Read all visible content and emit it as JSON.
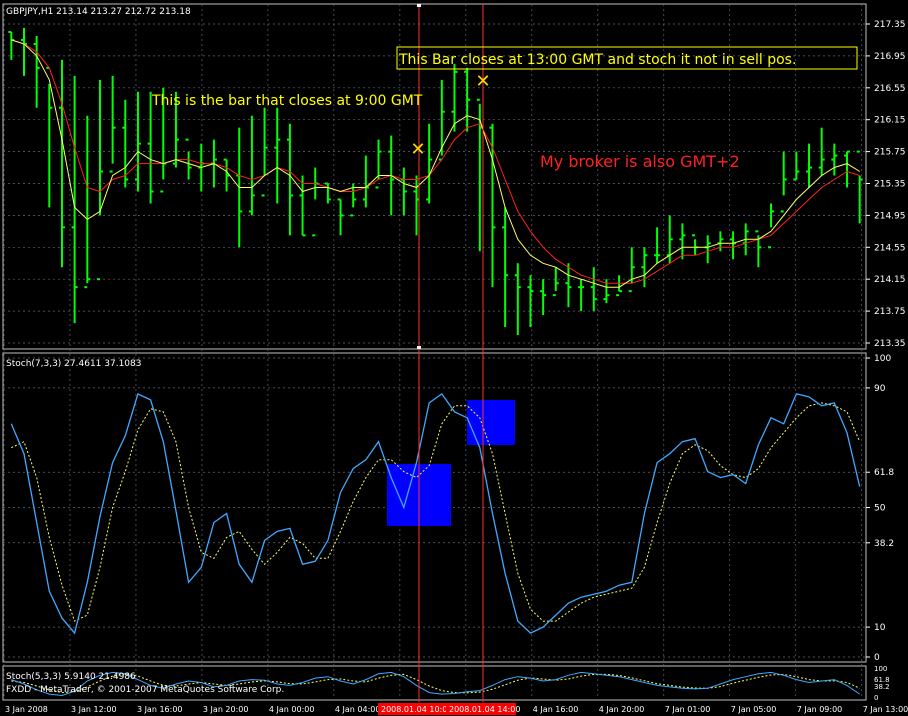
{
  "window": {
    "symbol_header": "GBPJPY,H1  213.14 213.27 212.72 213.18",
    "copyright": "FXDD - MetaTrader, © 2001-2007 MetaQuotes Software Corp."
  },
  "annotations": {
    "bar_9": "This is the bar that closes at 9:00 GMT",
    "bar_13": "This Bar closes at 13:00 GMT and stoch it not in sell pos.",
    "broker": "My broker is also GMT+2"
  },
  "colors": {
    "background": "#000000",
    "grid": "#5a6a78",
    "candle": "#00ff00",
    "ma_fast": "#ffff66",
    "ma_slow": "#ff2020",
    "stoch_main": "#3fa9ff",
    "stoch_signal": "#ffff66",
    "highlight_box": "#0000ff",
    "vline": "#ff3030",
    "axis_text": "#ffffff",
    "note_yellow": "#ffff00",
    "note_red": "#ff2020"
  },
  "chart_data": [
    {
      "type": "candlestick",
      "title": "GBPJPY,H1  213.14 213.27 212.72 213.18",
      "y_ticks": [
        "217.35",
        "216.95",
        "216.55",
        "216.15",
        "215.75",
        "215.35",
        "214.95",
        "214.55",
        "214.15",
        "213.75",
        "213.35"
      ],
      "ylim": [
        213.3,
        217.5
      ],
      "close": [
        217.15,
        217.1,
        216.8,
        216.3,
        214.8,
        214.05,
        214.15,
        215.5,
        216.05,
        215.4,
        215.85,
        215.25,
        215.6,
        215.9,
        215.55,
        215.6,
        215.65,
        215.45,
        215.0,
        215.2,
        215.8,
        215.9,
        215.2,
        214.7,
        215.35,
        215.15,
        214.95,
        215.15,
        215.3,
        215.75,
        215.4,
        215.25,
        215.15,
        215.65,
        216.25,
        216.75,
        216.4,
        216.05,
        214.8,
        214.2,
        214.05,
        214.0,
        213.95,
        214.1,
        214.05,
        214.05,
        213.9,
        213.95,
        214.0,
        214.3,
        214.45,
        214.45,
        214.65,
        214.7,
        214.55,
        214.6,
        214.65,
        214.6,
        214.75,
        214.55,
        215.0,
        215.4,
        215.5,
        215.55,
        215.65,
        215.7,
        215.75,
        215.4
      ],
      "high": [
        217.25,
        217.3,
        217.2,
        216.6,
        216.9,
        216.7,
        216.2,
        216.65,
        216.7,
        216.4,
        216.5,
        216.5,
        216.55,
        216.5,
        215.75,
        215.85,
        215.9,
        215.65,
        216.05,
        216.2,
        216.3,
        216.3,
        216.1,
        215.45,
        215.55,
        215.35,
        215.15,
        215.35,
        215.7,
        215.9,
        215.95,
        215.55,
        215.45,
        216.1,
        216.65,
        216.85,
        216.8,
        216.35,
        216.1,
        215.05,
        214.35,
        214.2,
        214.15,
        214.3,
        214.35,
        214.15,
        214.3,
        214.15,
        214.2,
        214.55,
        214.55,
        214.8,
        214.95,
        214.85,
        214.65,
        214.7,
        214.75,
        214.75,
        214.85,
        214.7,
        215.1,
        215.75,
        215.75,
        215.85,
        216.05,
        215.85,
        215.75,
        215.45
      ],
      "low": [
        216.9,
        216.7,
        216.3,
        215.05,
        214.3,
        213.6,
        214.1,
        214.95,
        215.6,
        215.3,
        215.25,
        215.1,
        215.4,
        215.55,
        215.4,
        215.25,
        215.3,
        215.25,
        214.55,
        214.95,
        215.45,
        215.1,
        214.7,
        214.7,
        215.15,
        215.1,
        214.7,
        215.05,
        215.05,
        215.4,
        214.95,
        214.95,
        214.7,
        215.1,
        215.7,
        216.0,
        216.0,
        214.5,
        214.05,
        213.55,
        213.45,
        213.55,
        213.7,
        214.0,
        213.8,
        213.75,
        213.75,
        213.85,
        214.0,
        214.1,
        214.05,
        214.35,
        214.35,
        214.4,
        214.45,
        214.35,
        214.5,
        214.4,
        214.45,
        214.3,
        214.8,
        215.2,
        215.4,
        215.3,
        215.45,
        215.45,
        215.3,
        214.85
      ],
      "ma_fast": [
        217.15,
        217.1,
        216.95,
        216.65,
        215.9,
        215.05,
        214.9,
        215.0,
        215.45,
        215.55,
        215.75,
        215.65,
        215.6,
        215.65,
        215.6,
        215.55,
        215.6,
        215.5,
        215.3,
        215.3,
        215.45,
        215.55,
        215.45,
        215.25,
        215.3,
        215.3,
        215.25,
        215.3,
        215.3,
        215.45,
        215.45,
        215.35,
        215.3,
        215.45,
        215.8,
        216.1,
        216.2,
        216.15,
        215.65,
        215.05,
        214.65,
        214.45,
        214.35,
        214.3,
        214.2,
        214.15,
        214.1,
        214.05,
        214.05,
        214.15,
        214.2,
        214.35,
        214.45,
        214.55,
        214.55,
        214.55,
        214.6,
        214.6,
        214.65,
        214.65,
        214.75,
        214.95,
        215.15,
        215.3,
        215.45,
        215.55,
        215.6,
        215.5
      ],
      "ma_slow": [
        217.15,
        217.1,
        217.0,
        216.8,
        216.35,
        215.8,
        215.3,
        215.25,
        215.4,
        215.45,
        215.6,
        215.6,
        215.6,
        215.65,
        215.65,
        215.6,
        215.6,
        215.55,
        215.45,
        215.4,
        215.45,
        215.55,
        215.5,
        215.35,
        215.35,
        215.3,
        215.25,
        215.25,
        215.3,
        215.4,
        215.45,
        215.4,
        215.4,
        215.45,
        215.65,
        215.9,
        216.05,
        216.1,
        215.8,
        215.4,
        215.0,
        214.75,
        214.55,
        214.4,
        214.3,
        214.2,
        214.15,
        214.1,
        214.1,
        214.1,
        214.15,
        214.25,
        214.35,
        214.45,
        214.45,
        214.5,
        214.55,
        214.55,
        214.6,
        214.65,
        214.7,
        214.85,
        215.0,
        215.15,
        215.3,
        215.4,
        215.5,
        215.45
      ]
    },
    {
      "type": "line",
      "title": "Stoch(7,3,3) 27.4611 37.1083",
      "y_ticks": [
        "100",
        "90",
        "61.8",
        "50",
        "38.2",
        "10",
        "0"
      ],
      "ylim": [
        0,
        100
      ],
      "series": [
        {
          "values": [
            78,
            68,
            45,
            22,
            13,
            8,
            25,
            47,
            65,
            74,
            88,
            86,
            72,
            49,
            25,
            30,
            45,
            48,
            31,
            25,
            39,
            42,
            43,
            31,
            32,
            39,
            55,
            63,
            66,
            72,
            60,
            50,
            65,
            85,
            88,
            82,
            80,
            70,
            48,
            28,
            12,
            8,
            10,
            14,
            18,
            20,
            21,
            22,
            24,
            25,
            48,
            65,
            68,
            72,
            73,
            62,
            60,
            61,
            58,
            71,
            80,
            78,
            88,
            87,
            84,
            85,
            75,
            57
          ]
        },
        {
          "values": [
            70,
            72,
            60,
            40,
            24,
            12,
            14,
            30,
            50,
            62,
            76,
            83,
            82,
            72,
            50,
            35,
            33,
            40,
            42,
            36,
            31,
            35,
            40,
            38,
            33,
            33,
            42,
            52,
            60,
            66,
            66,
            62,
            60,
            64,
            78,
            84,
            84,
            80,
            68,
            48,
            28,
            16,
            12,
            12,
            15,
            18,
            20,
            21,
            22,
            23,
            30,
            45,
            58,
            68,
            71,
            69,
            64,
            61,
            60,
            63,
            70,
            75,
            80,
            84,
            85,
            84,
            82,
            72
          ]
        }
      ]
    },
    {
      "type": "line",
      "title": "Stoch(5,3,3) 5.9140 21.4986",
      "y_ticks": [
        "100",
        "61.8",
        "38.2",
        "0"
      ],
      "ylim": [
        0,
        100
      ],
      "series": [
        {
          "values": [
            60,
            45,
            25,
            10,
            5,
            20,
            55,
            75,
            85,
            80,
            60,
            40,
            30,
            45,
            55,
            50,
            35,
            40,
            55,
            60,
            58,
            45,
            40,
            50,
            65,
            70,
            55,
            45,
            60,
            80,
            85,
            70,
            40,
            15,
            10,
            12,
            18,
            22,
            40,
            60,
            70,
            65,
            55,
            60,
            75,
            85,
            80,
            75,
            70,
            60,
            50,
            40,
            35,
            30,
            28,
            30,
            45,
            60,
            70,
            80,
            85,
            75,
            60,
            50,
            55,
            60,
            40,
            10
          ]
        },
        {
          "values": [
            55,
            50,
            38,
            25,
            15,
            18,
            35,
            55,
            72,
            80,
            72,
            55,
            40,
            38,
            45,
            50,
            45,
            40,
            45,
            52,
            56,
            52,
            46,
            45,
            52,
            60,
            62,
            55,
            52,
            65,
            75,
            78,
            60,
            38,
            22,
            15,
            14,
            17,
            27,
            42,
            58,
            66,
            62,
            58,
            62,
            72,
            78,
            78,
            74,
            66,
            56,
            46,
            40,
            34,
            31,
            30,
            36,
            48,
            58,
            68,
            76,
            78,
            70,
            60,
            55,
            56,
            50,
            30
          ]
        }
      ]
    }
  ],
  "x_axis": {
    "labels": [
      "3 Jan 2008",
      "3 Jan 12:00",
      "3 Jan 16:00",
      "3 Jan 20:00",
      "4 Jan 00:00",
      "4 Jan 04:00",
      "2008.01.04 10:00",
      "2008.01.04 14:00",
      "4 Jan 16:00",
      "4 Jan 20:00",
      "7 Jan 01:00",
      "7 Jan 05:00",
      "7 Jan 09:00",
      "7 Jan 13:00"
    ]
  }
}
